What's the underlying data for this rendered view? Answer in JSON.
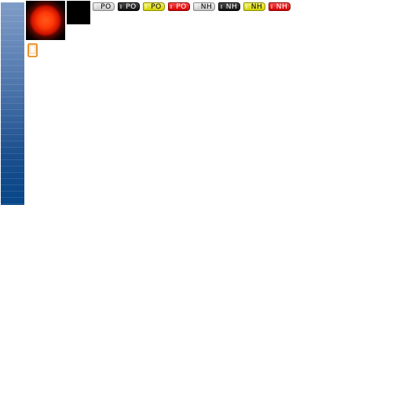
{
  "toolbar": {
    "buttons": [
      {
        "label": "PO",
        "style": "light"
      },
      {
        "label": "PO",
        "style": "dark"
      },
      {
        "label": "PO",
        "style": "yellow"
      },
      {
        "label": "PO",
        "style": "red"
      },
      {
        "label": "NH",
        "style": "light"
      },
      {
        "label": "NH",
        "style": "dark"
      },
      {
        "label": "NH",
        "style": "yellow"
      },
      {
        "label": "NH",
        "style": "red"
      }
    ]
  },
  "colors": {
    "strip_top": "#7f9cc7",
    "strip_bottom": "#064688",
    "glow": "#ff3a08",
    "pill_light": "#d9d9d9",
    "pill_dark": "#1e1e1e",
    "pill_yellow": "#e0e000",
    "pill_red": "#e00000",
    "device_icon": "#e07a00"
  },
  "icons": {
    "glow_tile": "red-glow-orb-icon",
    "device": "mobile-device-icon"
  }
}
